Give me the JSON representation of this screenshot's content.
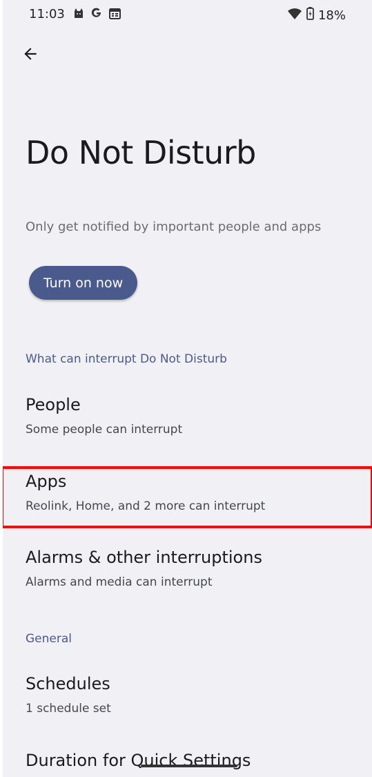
{
  "status_bar": {
    "time": "11:03",
    "battery": "18%",
    "left_icons": [
      "cat-icon",
      "google-g-icon",
      "calendar-icon"
    ],
    "right_icons": [
      "wifi-icon",
      "battery-charging-icon"
    ]
  },
  "header": {
    "title": "Do Not Disturb",
    "description": "Only get notified by important people and apps",
    "turn_on_label": "Turn on now"
  },
  "sections": {
    "interrupt_header": "What can interrupt Do Not Disturb",
    "general_header": "General"
  },
  "items": {
    "people": {
      "title": "People",
      "summary": "Some people can interrupt"
    },
    "apps": {
      "title": "Apps",
      "summary": "Reolink, Home, and 2 more can interrupt"
    },
    "alarms": {
      "title": "Alarms & other interruptions",
      "summary": "Alarms and media can interrupt"
    },
    "schedules": {
      "title": "Schedules",
      "summary": "1 schedule set"
    },
    "duration": {
      "title": "Duration for Quick Settings"
    }
  },
  "colors": {
    "accent": "#4a5a8c",
    "background": "#f1f0f4",
    "highlight": "#ff0000"
  }
}
